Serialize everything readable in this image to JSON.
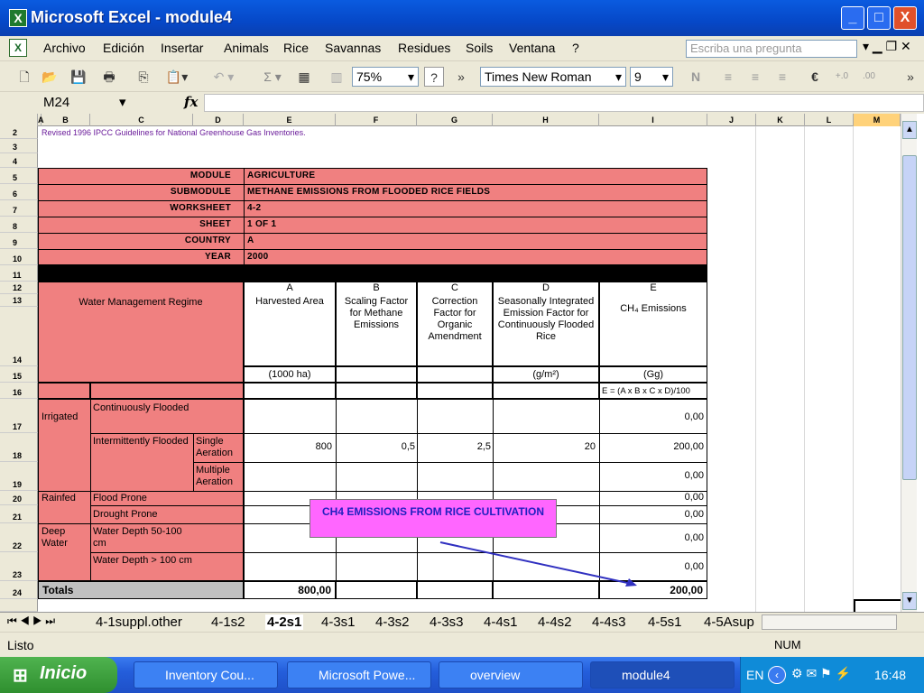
{
  "window": {
    "title": "Microsoft Excel - module4",
    "minimize": "_",
    "maximize": "□",
    "close": "X"
  },
  "menu": {
    "items": [
      "Archivo",
      "Edición",
      "Insertar",
      "Animals",
      "Rice",
      "Savannas",
      "Residues",
      "Soils",
      "Ventana",
      "?"
    ],
    "ask_placeholder": "Escriba una pregunta"
  },
  "toolbar": {
    "zoom": "75%",
    "font": "Times New Roman",
    "size": "9",
    "help": "?"
  },
  "formula": {
    "name_box": "M24",
    "fx": "fx"
  },
  "columns": [
    "A",
    "B",
    "C",
    "D",
    "E",
    "F",
    "G",
    "H",
    "I",
    "J",
    "K",
    "L",
    "M"
  ],
  "rows": [
    "2",
    "3",
    "4",
    "5",
    "6",
    "7",
    "8",
    "9",
    "10",
    "11",
    "12",
    "13",
    "14",
    "15",
    "16",
    "17",
    "18",
    "19",
    "20",
    "21",
    "22",
    "23",
    "24"
  ],
  "sheet": {
    "guideline_note": "Revised 1996 IPCC Guidelines for National Greenhouse Gas Inventories.",
    "module_label": "MODULE",
    "module_value": "AGRICULTURE",
    "submodule_label": "SUBMODULE",
    "submodule_value": "METHANE EMISSIONS FROM FLOODED RICE FIELDS",
    "worksheet_label": "WORKSHEET",
    "worksheet_value": "4-2",
    "sheet_label": "SHEET",
    "sheet_value": "1 OF 1",
    "country_label": "COUNTRY",
    "country_value": "A",
    "year_label": "YEAR",
    "year_value": "2000",
    "water_regime": "Water Management Regime",
    "col_a_letter": "A",
    "col_a_name": "Harvested Area",
    "col_a_unit": "(1000 ha)",
    "col_b_letter": "B",
    "col_b_name": "Scaling Factor for Methane Emissions",
    "col_c_letter": "C",
    "col_c_name": "Correction Factor for Organic Amendment",
    "col_d_letter": "D",
    "col_d_name": "Seasonally Integrated Emission Factor for Continuously Flooded Rice",
    "col_d_unit": "(g/m²)",
    "col_e_letter": "E",
    "col_e_name": "CH₄ Emissions",
    "col_e_unit": "(Gg)",
    "formula_note": "E = (A x B x C x D)/100",
    "irrigated": "Irrigated",
    "continuously_flooded": "Continuously Flooded",
    "cf_e": "0,00",
    "intermittently_flooded": "Intermittently Flooded",
    "single_aeration": "Single Aeration",
    "sa_a": "800",
    "sa_b": "0,5",
    "sa_c": "2,5",
    "sa_d": "20",
    "sa_e": "200,00",
    "multiple_aeration": "Multiple Aeration",
    "ma_e": "0,00",
    "rainfed": "Rainfed",
    "flood_prone": "Flood Prone",
    "fp_e": "0,00",
    "drought_prone": "Drought Prone",
    "dp_e": "0,00",
    "deep_water": "Deep Water",
    "water_depth_50": "Water Depth 50-100 cm",
    "wd50_e": "0,00",
    "water_depth_100": "Water Depth > 100 cm",
    "wd100_e": "0,00",
    "totals": "Totals",
    "total_a": "800,00",
    "total_e": "200,00",
    "callout": "CH4 EMISSIONS FROM RICE CULTIVATION"
  },
  "tabs": [
    "4-1suppl.other",
    "4-1s2",
    "4-2s1",
    "4-3s1",
    "4-3s2",
    "4-3s3",
    "4-4s1",
    "4-4s2",
    "4-4s3",
    "4-5s1",
    "4-5Asup"
  ],
  "status": {
    "left": "Listo",
    "num": "NUM"
  },
  "taskbar": {
    "start": "Inicio",
    "tasks": [
      "Inventory Cou...",
      "Microsoft Powe...",
      "overview",
      "module4"
    ],
    "lang": "EN",
    "clock": "16:48"
  }
}
